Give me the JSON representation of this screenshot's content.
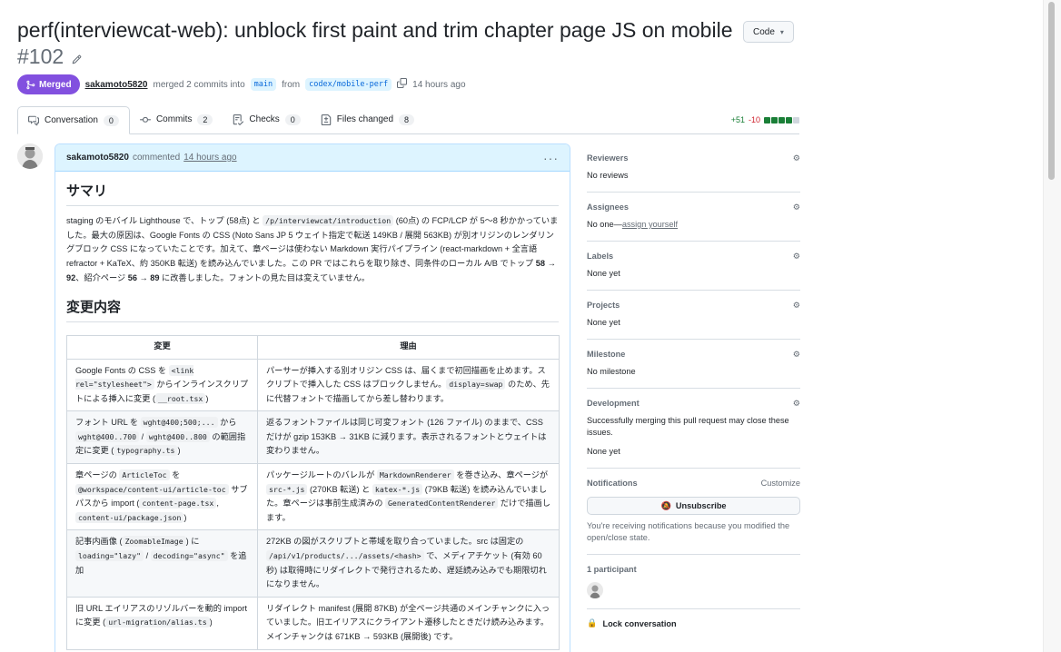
{
  "pr": {
    "title": "perf(interviewcat-web): unblock first paint and trim chapter page JS on mobile",
    "number": "#102",
    "status": "Merged",
    "author": "sakamoto5820",
    "merged_text": "merged 2 commits into",
    "base_branch": "main",
    "from_text": "from",
    "head_branch": "codex/mobile-perf",
    "time": "14 hours ago",
    "code_button": "Code"
  },
  "tabs": [
    {
      "label": "Conversation",
      "count": "0",
      "icon": "comment-discussion-icon"
    },
    {
      "label": "Commits",
      "count": "2",
      "icon": "git-commit-icon"
    },
    {
      "label": "Checks",
      "count": "0",
      "icon": "checklist-icon"
    },
    {
      "label": "Files changed",
      "count": "8",
      "icon": "file-diff-icon"
    }
  ],
  "diffstat": {
    "additions": "+51",
    "deletions": "-10",
    "colors": [
      "#1a7f37",
      "#1a7f37",
      "#1a7f37",
      "#1a7f37",
      "#d0d7de"
    ]
  },
  "comment": {
    "author": "sakamoto5820",
    "action": "commented",
    "time": "14 hours ago",
    "summary_heading": "サマリ",
    "summary_p1": "staging のモバイル Lighthouse で、トップ (58点) と",
    "summary_code1": "/p/interviewcat/introduction",
    "summary_p2": "(60点) の FCP/LCP が 5〜8 秒かかっていました。最大の原因は、Google Fonts の CSS (Noto Sans JP 5 ウェイト指定で転送 149KB / 展開 563KB) が別オリジンのレンダリングブロック CSS になっていたことです。加えて、章ページは使わない Markdown 実行パイプライン (react-markdown + 全言語 refractor + KaTeX、約 350KB 転送) を読み込んでいました。この PR ではこれらを取り除き、同条件のローカル A/B でトップ",
    "summary_b1": "58 → 92",
    "summary_p3": "、紹介ページ",
    "summary_b2": "56 → 89",
    "summary_p4": "に改善しました。フォントの見た目は変えていません。",
    "changes_heading": "変更内容",
    "table_headers": [
      "変更",
      "理由"
    ],
    "rows": [
      {
        "change": [
          {
            "t": "Google Fonts の CSS を "
          },
          {
            "c": "<link rel=\"stylesheet\">"
          },
          {
            "t": " からインラインスクリプトによる挿入に変更 ("
          },
          {
            "c": "__root.tsx"
          },
          {
            "t": ")"
          }
        ],
        "reason": [
          {
            "t": "パーサーが挿入する別オリジン CSS は、届くまで初回描画を止めます。スクリプトで挿入した CSS はブロックしません。"
          },
          {
            "c": "display=swap"
          },
          {
            "t": " のため、先に代替フォントで描画してから差し替わります。"
          }
        ]
      },
      {
        "change": [
          {
            "t": "フォント URL を "
          },
          {
            "c": "wght@400;500;..."
          },
          {
            "t": " から "
          },
          {
            "c": "wght@400..700"
          },
          {
            "t": " / "
          },
          {
            "c": "wght@400..800"
          },
          {
            "t": " の範囲指定に変更 ("
          },
          {
            "c": "typography.ts"
          },
          {
            "t": ")"
          }
        ],
        "reason": [
          {
            "t": "返るフォントファイルは同じ可変フォント (126 ファイル) のままで、CSS だけが gzip 153KB → 31KB に減ります。表示されるフォントとウェイトは変わりません。"
          }
        ]
      },
      {
        "change": [
          {
            "t": "章ページの "
          },
          {
            "c": "ArticleToc"
          },
          {
            "t": " を "
          },
          {
            "c": "@workspace/content-ui/article-toc"
          },
          {
            "t": " サブパスから import ("
          },
          {
            "c": "content-page.tsx"
          },
          {
            "t": ", "
          },
          {
            "c": "content-ui/package.json"
          },
          {
            "t": ")"
          }
        ],
        "reason": [
          {
            "t": "パッケージルートのバレルが "
          },
          {
            "c": "MarkdownRenderer"
          },
          {
            "t": " を巻き込み、章ページが "
          },
          {
            "c": "src-*.js"
          },
          {
            "t": " (270KB 転送) と "
          },
          {
            "c": "katex-*.js"
          },
          {
            "t": " (79KB 転送) を読み込んでいました。章ページは事前生成済みの "
          },
          {
            "c": "GeneratedContentRenderer"
          },
          {
            "t": " だけで描画します。"
          }
        ]
      },
      {
        "change": [
          {
            "t": "記事内画像 ("
          },
          {
            "c": "ZoomableImage"
          },
          {
            "t": ") に "
          },
          {
            "c": "loading=\"lazy\""
          },
          {
            "t": " / "
          },
          {
            "c": "decoding=\"async\""
          },
          {
            "t": " を追加"
          }
        ],
        "reason": [
          {
            "t": "272KB の図がスクリプトと帯域を取り合っていました。src は固定の "
          },
          {
            "c": "/api/v1/products/.../assets/<hash>"
          },
          {
            "t": " で、メディアチケット (有効 60 秒) は取得時にリダイレクトで発行されるため、遅延読み込みでも期限切れになりません。"
          }
        ]
      },
      {
        "change": [
          {
            "t": "旧 URL エイリアスのリゾルバーを動的 import に変更 ("
          },
          {
            "c": "url-migration/alias.ts"
          },
          {
            "t": ")"
          }
        ],
        "reason": [
          {
            "t": "リダイレクト manifest (展開 87KB) が全ページ共通のメインチャンクに入っていました。旧エイリアスにクライアント遷移したときだけ読み込みます。メインチャンクは 671KB → 593KB (展開後) です。"
          }
        ]
      }
    ]
  },
  "sidebar": {
    "reviewers_label": "Reviewers",
    "reviewers_value": "No reviews",
    "assignees_label": "Assignees",
    "assignees_value": "No one—",
    "assignees_link": "assign yourself",
    "labels_label": "Labels",
    "labels_value": "None yet",
    "projects_label": "Projects",
    "projects_value": "None yet",
    "milestone_label": "Milestone",
    "milestone_value": "No milestone",
    "development_label": "Development",
    "development_text": "Successfully merging this pull request may close these issues.",
    "development_value": "None yet",
    "notifications_label": "Notifications",
    "customize_label": "Customize",
    "unsubscribe_label": "Unsubscribe",
    "notifications_reason": "You're receiving notifications because you modified the open/close state.",
    "participants_label": "1 participant",
    "lock_label": "Lock conversation"
  }
}
